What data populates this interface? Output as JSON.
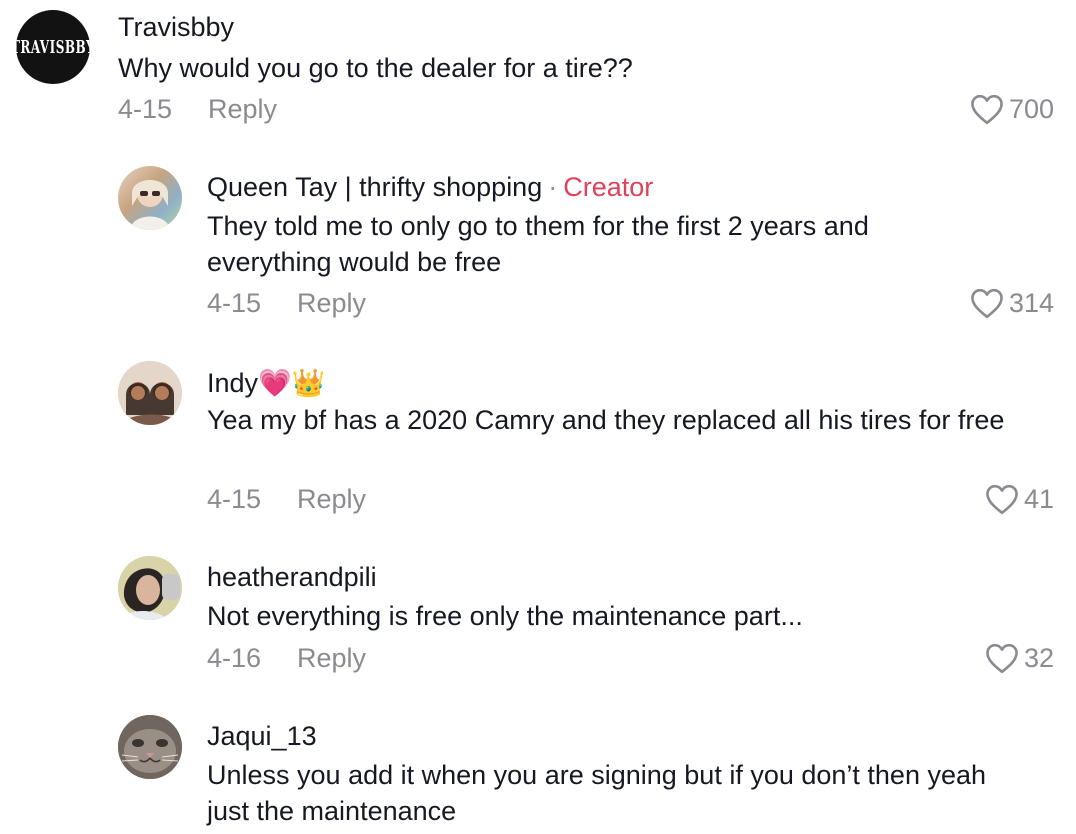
{
  "comments": [
    {
      "username": "Travisbby",
      "avatar_text": "TRAVISBBY",
      "text": "Why would you go to the dealer for a tire??",
      "date": "4-15",
      "reply_label": "Reply",
      "likes": "700"
    },
    {
      "username": "Queen Tay | thrifty shopping",
      "creator_separator": "·",
      "creator_label": "Creator",
      "text": "They told me to only go to them for the first 2 years and everything would be free",
      "date": "4-15",
      "reply_label": "Reply",
      "likes": "314"
    },
    {
      "username": "Indy💗👑",
      "text": "Yea my bf has a 2020 Camry and they replaced all his tires for free",
      "date": "4-15",
      "reply_label": "Reply",
      "likes": "41"
    },
    {
      "username": "heatherandpili",
      "text": "Not everything is free only the maintenance part...",
      "date": "4-16",
      "reply_label": "Reply",
      "likes": "32"
    },
    {
      "username": "Jaqui_13",
      "text": "Unless you add it when you are signing but if you don’t then yeah just the maintenance"
    }
  ],
  "colors": {
    "text": "#161823",
    "muted": "#8a8b91",
    "creator": "#e0405a"
  },
  "icons": {
    "like": "heart-outline-icon"
  }
}
